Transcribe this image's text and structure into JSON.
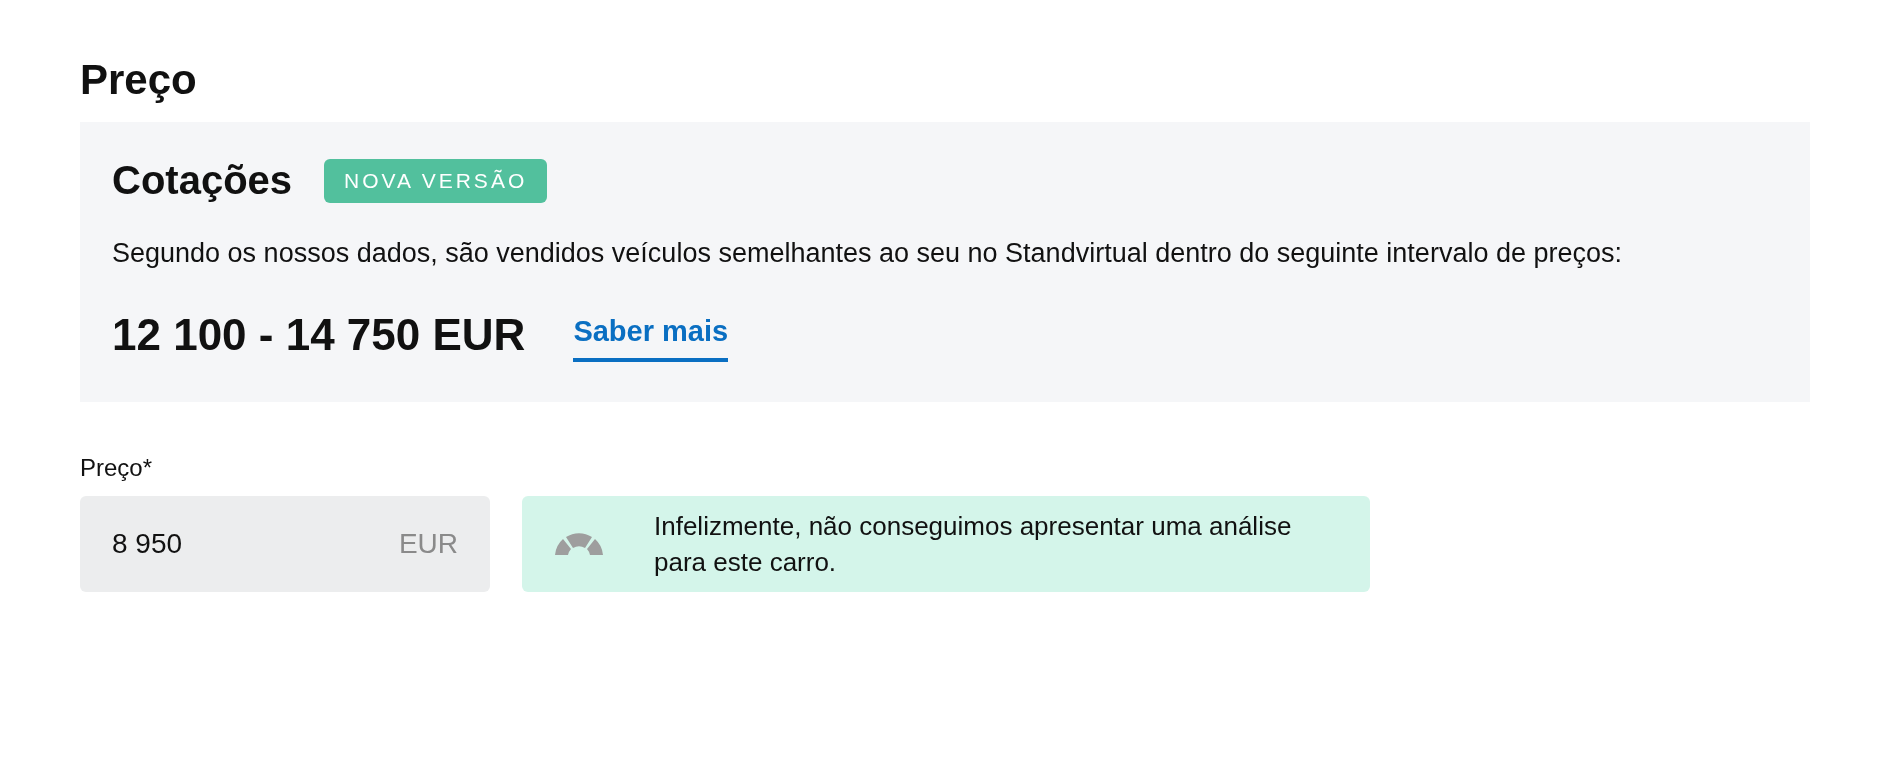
{
  "section_title": "Preço",
  "quote_panel": {
    "title": "Cotações",
    "badge": "NOVA VERSÃO",
    "description": "Segundo os nossos dados, são vendidos veículos semelhantes ao seu no Standvirtual dentro do seguinte intervalo de preços:",
    "price_range": "12 100 - 14 750 EUR",
    "link": "Saber mais"
  },
  "price_field": {
    "label": "Preço*",
    "value": "8 950",
    "unit": "EUR"
  },
  "notice": {
    "message": "Infelizmente, não conseguimos apresentar uma análise para este carro."
  }
}
